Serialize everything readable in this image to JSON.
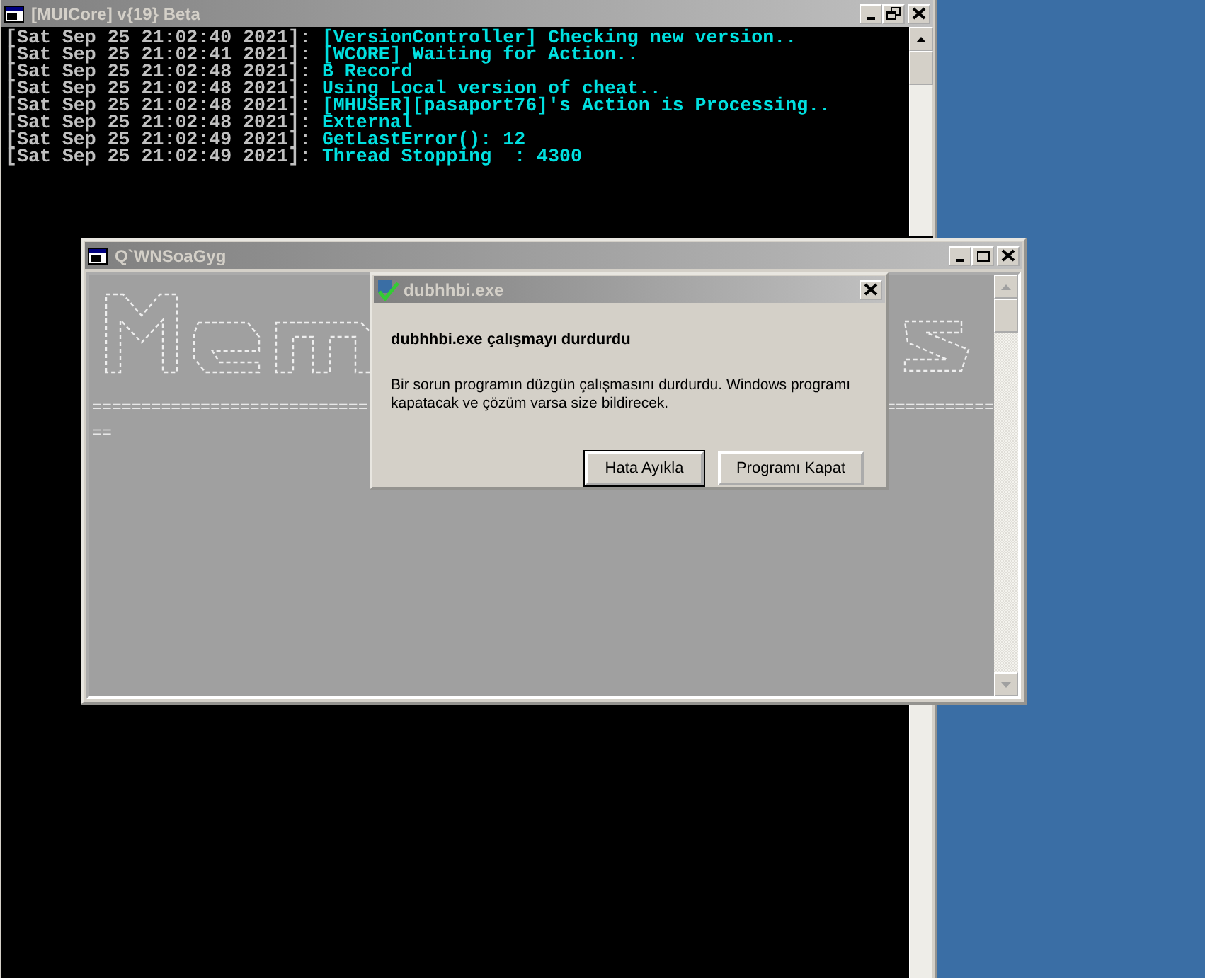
{
  "console_window": {
    "title": "[MUICore] v{19} Beta",
    "lines": [
      {
        "timestamp": "[Sat Sep 25 21:02:40 2021]:",
        "message": "[VersionController] Checking new version.."
      },
      {
        "timestamp": "[Sat Sep 25 21:02:41 2021]:",
        "message": "[WCORE] Waiting for Action.."
      },
      {
        "timestamp": "[Sat Sep 25 21:02:48 2021]:",
        "message": "B Record"
      },
      {
        "timestamp": "[Sat Sep 25 21:02:48 2021]:",
        "message": "Using Local version of cheat.."
      },
      {
        "timestamp": "[Sat Sep 25 21:02:48 2021]:",
        "message": "[MHUSER][pasaport76]'s Action is Processing.."
      },
      {
        "timestamp": "[Sat Sep 25 21:02:48 2021]:",
        "message": "External"
      },
      {
        "timestamp": "[Sat Sep 25 21:02:49 2021]:",
        "message": "GetLastError(): 12"
      },
      {
        "timestamp": "[Sat Sep 25 21:02:49 2021]:",
        "message": "Thread Stopping  : 4300"
      }
    ]
  },
  "app_window": {
    "title": "Q`WNSoaGyg",
    "separator_left": "============================",
    "separator_right": "===========",
    "separator_tail": "=="
  },
  "error_dialog": {
    "title": "dubhhbi.exe",
    "heading": "dubhhbi.exe çalışmayı durdurdu",
    "message": "Bir sorun programın düzgün çalışmasını durdurdu. Windows programı kapatacak ve çözüm varsa size bildirecek.",
    "buttons": [
      {
        "label": "Hata Ayıkla",
        "default": true
      },
      {
        "label": "Programı Kapat",
        "default": false
      }
    ]
  }
}
